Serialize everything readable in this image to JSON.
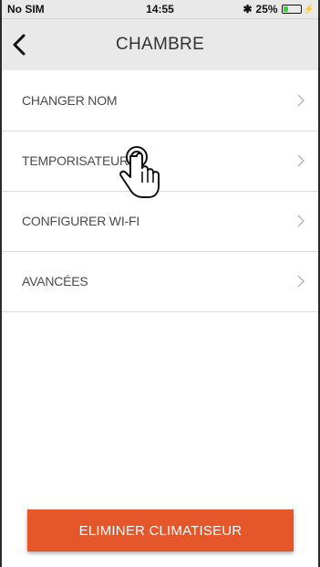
{
  "status_bar": {
    "carrier": "No SIM",
    "time": "14:55",
    "bluetooth_icon": "bluetooth-icon",
    "battery_text": "25%",
    "battery_level_percent": 25,
    "battery_color": "#36d341"
  },
  "nav": {
    "title": "CHAMBRE",
    "back_icon": "chevron-left-icon"
  },
  "menu": {
    "items": [
      {
        "label": "CHANGER NOM"
      },
      {
        "label": "TEMPORISATEUR"
      },
      {
        "label": "CONFIGURER WI-FI"
      },
      {
        "label": "AVANCÉES"
      }
    ],
    "chevron_icon": "chevron-right-icon"
  },
  "footer": {
    "delete_label": "ELIMINER CLIMATISEUR",
    "button_color": "#e6562b"
  },
  "overlay": {
    "icon": "tap-hand-icon"
  }
}
